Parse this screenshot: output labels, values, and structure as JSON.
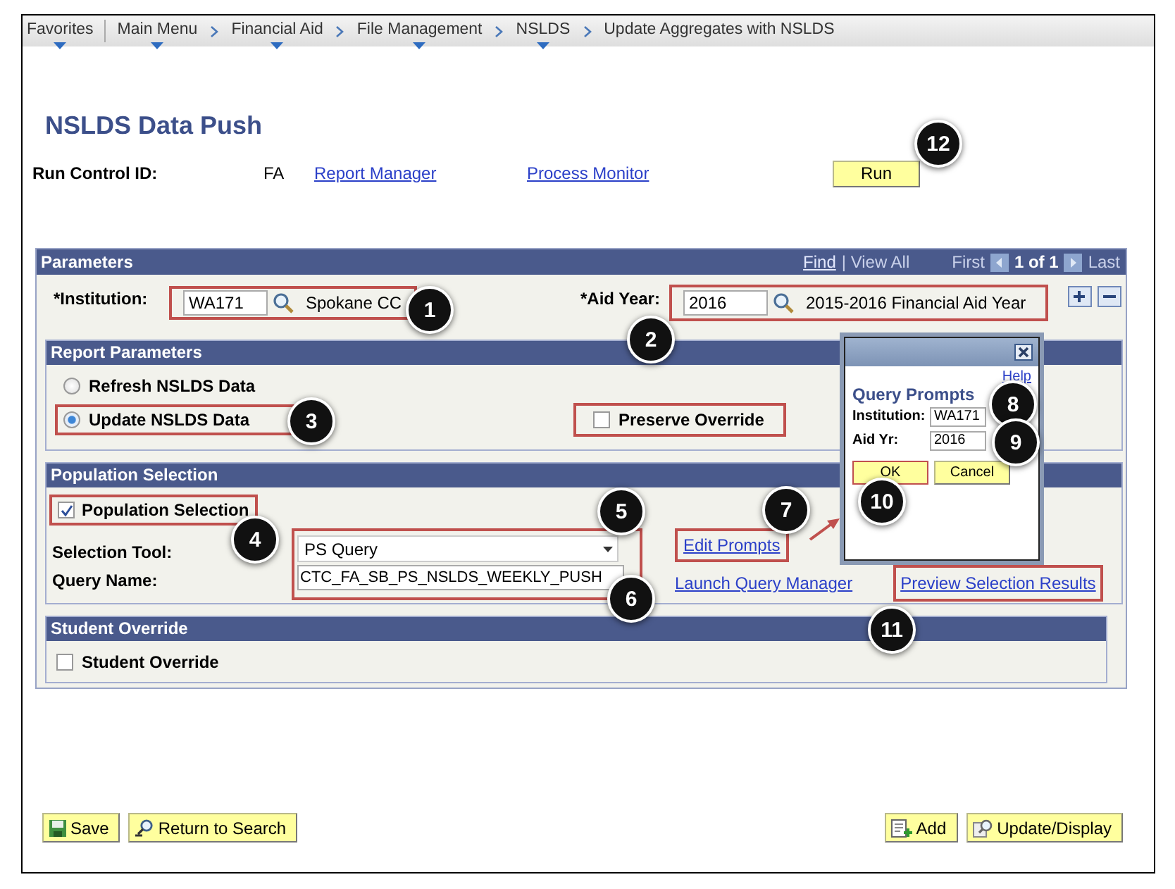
{
  "breadcrumb": [
    {
      "label": "Favorites",
      "menu": true
    },
    {
      "label": "Main Menu",
      "menu": true
    },
    {
      "label": "Financial Aid",
      "menu": true
    },
    {
      "label": "File Management",
      "menu": true
    },
    {
      "label": "NSLDS",
      "menu": true
    },
    {
      "label": "Update Aggregates with NSLDS",
      "menu": false
    }
  ],
  "page_title": "NSLDS Data Push",
  "run_control": {
    "label": "Run Control ID:",
    "value": "FA",
    "links": [
      "Report Manager",
      "Process Monitor"
    ],
    "run_button": "Run"
  },
  "parameters": {
    "title": "Parameters",
    "find": "Find",
    "view_all": "| View All",
    "first": "First",
    "count": "1 of 1",
    "last": "Last",
    "institution": {
      "label": "*Institution:",
      "value": "WA171",
      "description": "Spokane CC"
    },
    "aid_year": {
      "label": "*Aid Year:",
      "value": "2016",
      "description": "2015-2016 Financial Aid Year"
    }
  },
  "report_parameters": {
    "title": "Report Parameters",
    "options": [
      {
        "label": "Refresh NSLDS Data",
        "selected": false
      },
      {
        "label": "Update NSLDS Data",
        "selected": true
      }
    ],
    "preserve_override": {
      "label": "Preserve Override",
      "checked": false
    }
  },
  "population_selection": {
    "title": "Population Selection",
    "checkbox": {
      "label": "Population Selection",
      "checked": true
    },
    "selection_tool": {
      "label": "Selection Tool:",
      "value": "PS Query"
    },
    "query_name": {
      "label": "Query Name:",
      "value": "CTC_FA_SB_PS_NSLDS_WEEKLY_PUSH"
    },
    "edit_prompts": "Edit Prompts",
    "launch": "Launch Query Manager",
    "preview": "Preview Selection Results"
  },
  "student_override": {
    "title": "Student Override",
    "checkbox": {
      "label": "Student Override",
      "checked": false
    }
  },
  "dialog": {
    "help": "Help",
    "title": "Query Prompts",
    "fields": [
      {
        "label": "Institution:",
        "value": "WA171"
      },
      {
        "label": "Aid Yr:",
        "value": "2016"
      }
    ],
    "buttons": [
      "OK",
      "Cancel"
    ]
  },
  "footer": {
    "left": [
      {
        "label": "Save",
        "kind": "save"
      },
      {
        "label": "Return to Search",
        "kind": "search"
      }
    ],
    "right": [
      {
        "label": "Add",
        "kind": "add"
      },
      {
        "label": "Update/Display",
        "kind": "update"
      }
    ]
  },
  "callouts": [
    "1",
    "2",
    "3",
    "4",
    "5",
    "6",
    "7",
    "8",
    "9",
    "10",
    "11",
    "12"
  ]
}
